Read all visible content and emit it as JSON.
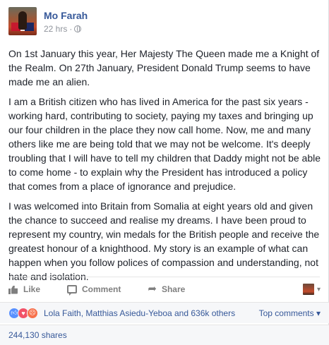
{
  "header": {
    "author": "Mo Farah",
    "time": "22 hrs",
    "separator": "·"
  },
  "content": {
    "paragraphs": [
      "On 1st January this year, Her Majesty The Queen made me a Knight of the Realm. On 27th January, President Donald Trump seems to have made me an alien.",
      "I am a British citizen who has lived in America for the past six years - working hard, contributing to society, paying my taxes and bringing up our four children in the place they now call home. Now, me and many others like me are being told that we may not be welcome. It's deeply troubling that I will have to tell my children that Daddy might not be able to come home - to explain why the President has introduced a policy that comes from a place of ignorance and prejudice.",
      "I was welcomed into Britain from Somalia at eight years old and given the chance to succeed and realise my dreams. I have been proud to represent my country, win medals for the British people and receive the greatest honour of a knighthood. My story is an example of what can happen when you follow polices of compassion and understanding, not hate and isolation."
    ]
  },
  "actions": {
    "like": "Like",
    "comment": "Comment",
    "share": "Share",
    "caret": "▾"
  },
  "reactions": {
    "summary": "Lola Faith, Matthias Asiedu-Yeboa and 636k others",
    "top_comments": "Top comments",
    "top_caret": "▾",
    "icons": [
      "like-reaction",
      "love-reaction",
      "angry-reaction"
    ]
  },
  "shares": {
    "label": "244,130 shares"
  }
}
